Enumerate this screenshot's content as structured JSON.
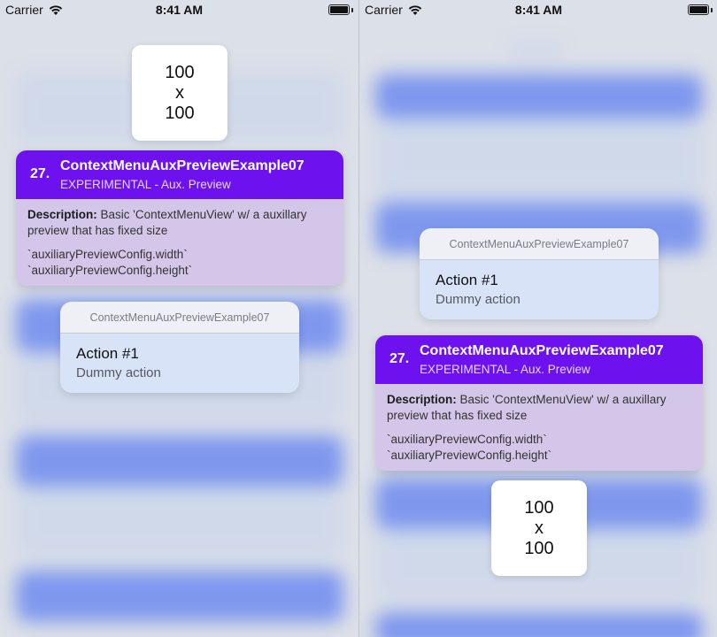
{
  "status_bar": {
    "carrier": "Carrier",
    "time": "8:41 AM"
  },
  "aux_preview": {
    "line1": "100",
    "line2": "x",
    "line3": "100"
  },
  "card": {
    "number": "27.",
    "title": "ContextMenuAuxPreviewExample07",
    "subtitle": "EXPERIMENTAL - Aux. Preview",
    "description_label": "Description:",
    "description_text": " Basic 'ContextMenuView' w/ a auxillary preview that has fixed size",
    "code_line1": "`auxiliaryPreviewConfig.width`",
    "code_line2": "`auxiliaryPreviewConfig.height`"
  },
  "menu": {
    "header": "ContextMenuAuxPreviewExample07",
    "action_title": "Action #1",
    "action_subtitle": "Dummy action"
  },
  "colors": {
    "card_header": "#6d12ee",
    "card_body": "#d4c6e9",
    "background_blue": "#4a6ff0",
    "menu_item": "#d9e3f7"
  }
}
